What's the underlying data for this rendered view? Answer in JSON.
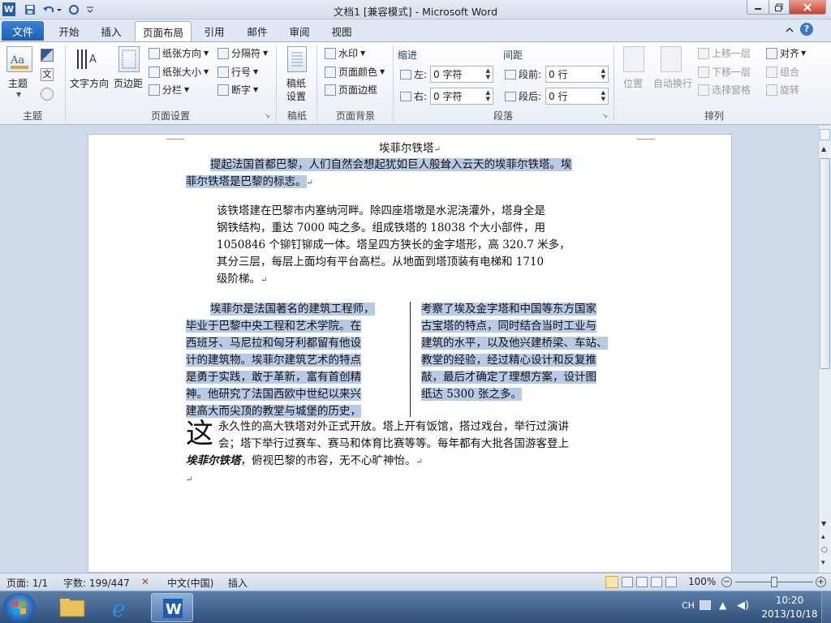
{
  "window": {
    "title": "文档1 [兼容模式] - Microsoft Word",
    "app_icon_letter": "W"
  },
  "tabs": {
    "file": "文件",
    "items": [
      "开始",
      "插入",
      "页面布局",
      "引用",
      "邮件",
      "审阅",
      "视图"
    ],
    "active": "页面布局"
  },
  "ribbon": {
    "theme": {
      "themes": "主题",
      "colors": "文",
      "label": "主题"
    },
    "page_setup": {
      "text_direction": "文字方向",
      "margins": "页边距",
      "orientation": "纸张方向",
      "size": "纸张大小",
      "columns": "分栏",
      "breaks": "分隔符",
      "line_numbers": "行号",
      "hyphenation": "断字",
      "label": "页面设置"
    },
    "draft": {
      "settings_line1": "稿纸",
      "settings_line2": "设置",
      "label": "稿纸"
    },
    "page_background": {
      "watermark": "水印",
      "page_color": "页面颜色",
      "page_borders": "页面边框",
      "label": "页面背景"
    },
    "paragraph": {
      "indent_title": "缩进",
      "spacing_title": "间距",
      "left_label": "左:",
      "left_value": "0 字符",
      "right_label": "右:",
      "right_value": "0 字符",
      "before_label": "段前:",
      "before_value": "0 行",
      "after_label": "段后:",
      "after_value": "0 行",
      "label": "段落"
    },
    "arrange": {
      "position": "位置",
      "wrap": "自动换行",
      "bring_forward": "上移一层",
      "send_backward": "下移一层",
      "selection_pane": "选择窗格",
      "align": "对齐",
      "group": "组合",
      "rotate": "旋转",
      "label": "排列"
    }
  },
  "document": {
    "heading": "埃菲尔铁塔",
    "p1_line1": "提起法国首都巴黎，人们自然会想起犹如巨人般耸入云天的埃菲尔铁塔。埃",
    "p1_line2": "菲尔铁塔是巴黎的标志。",
    "p2_lines": [
      "该铁塔建在巴黎市内塞纳河畔。除四座塔墩是水泥浇灌外，塔身全是",
      "钢铁结构，重达 7000 吨之多。组成铁塔的 18038 个大小部件，用",
      "1050846 个铆钉铆成一体。塔呈四方狭长的金字塔形，高 320.7 米多，",
      "其分三层，每层上面均有平台高栏。从地面到塔顶装有电梯和 1710",
      "级阶梯。"
    ],
    "col1_lines": [
      "埃菲尔是法国著名的建筑工程师，",
      "毕业于巴黎中央工程和艺术学院。在",
      "西班牙、马尼拉和匈牙利都留有他设",
      "计的建筑物。埃菲尔建筑艺术的特点",
      "是勇于实践，敢于革新，富有首创精",
      "神。他研究了法国西欧中世纪以来兴",
      "建高大而尖顶的教堂与城堡的历史，"
    ],
    "col2_lines": [
      "考察了埃及金字塔和中国等东方国家",
      "古宝塔的特点，同时结合当时工业与",
      "建筑的水平，以及他兴建桥梁、车站、",
      "教堂的经验，经过精心设计和反复推",
      "敲，最后才确定了理想方案，设计图",
      "纸达 5300 张之多。"
    ],
    "dropcap": "这",
    "p4_line1": "永久性的高大铁塔对外正式开放。塔上开有饭馆，搭过戏台，举行过演讲",
    "p4_line2": "会；塔下举行过赛车、赛马和体育比赛等等。每年都有大批各国游客登上",
    "p4_bold": "埃菲尔铁塔",
    "p4_line3_rest": "，俯视巴黎的市容，无不心旷神怡。"
  },
  "status": {
    "page": "页面: 1/1",
    "words": "字数: 199/447",
    "language": "中文(中国)",
    "mode": "插入",
    "zoom": "100%"
  },
  "taskbar": {
    "time": "10:20",
    "date": "2013/10/18",
    "input_method": "CH"
  },
  "colors": {
    "file_tab": "#1d5fb8",
    "selection": "#b7cbe7"
  }
}
